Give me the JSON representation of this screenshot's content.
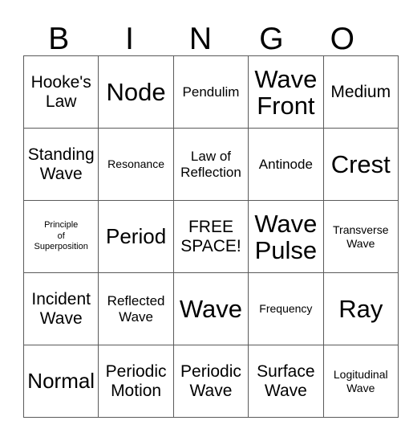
{
  "card": {
    "title": "BINGO",
    "headers": [
      "B",
      "I",
      "N",
      "G",
      "O"
    ],
    "free_space_label": "FREE SPACE!",
    "rows": [
      [
        {
          "text": "Hooke's\nLaw",
          "size": "lg",
          "free": false
        },
        {
          "text": "Node",
          "size": "xxl",
          "free": false
        },
        {
          "text": "Pendulim",
          "size": "md",
          "free": false
        },
        {
          "text": "Wave\nFront",
          "size": "xxl",
          "free": false
        },
        {
          "text": "Medium",
          "size": "lg",
          "free": false
        }
      ],
      [
        {
          "text": "Standing\nWave",
          "size": "lg",
          "free": false
        },
        {
          "text": "Resonance",
          "size": "sm",
          "free": false
        },
        {
          "text": "Law of\nReflection",
          "size": "md",
          "free": false
        },
        {
          "text": "Antinode",
          "size": "md",
          "free": false
        },
        {
          "text": "Crest",
          "size": "xxl",
          "free": false
        }
      ],
      [
        {
          "text": "Principle\nof\nSuperposition",
          "size": "xs",
          "free": false
        },
        {
          "text": "Period",
          "size": "xl",
          "free": false
        },
        {
          "text": "FREE\nSPACE!",
          "size": "lg",
          "free": true
        },
        {
          "text": "Wave\nPulse",
          "size": "xxl",
          "free": false
        },
        {
          "text": "Transverse\nWave",
          "size": "sm",
          "free": false
        }
      ],
      [
        {
          "text": "Incident\nWave",
          "size": "lg",
          "free": false
        },
        {
          "text": "Reflected\nWave",
          "size": "md",
          "free": false
        },
        {
          "text": "Wave",
          "size": "xxl",
          "free": false
        },
        {
          "text": "Frequency",
          "size": "sm",
          "free": false
        },
        {
          "text": "Ray",
          "size": "xxl",
          "free": false
        }
      ],
      [
        {
          "text": "Normal",
          "size": "xl",
          "free": false
        },
        {
          "text": "Periodic\nMotion",
          "size": "lg",
          "free": false
        },
        {
          "text": "Periodic\nWave",
          "size": "lg",
          "free": false
        },
        {
          "text": "Surface\nWave",
          "size": "lg",
          "free": false
        },
        {
          "text": "Logitudinal\nWave",
          "size": "sm",
          "free": false
        }
      ]
    ]
  },
  "colors": {
    "grid_line": "#5a5a5a",
    "text": "#000000",
    "background": "#ffffff"
  }
}
